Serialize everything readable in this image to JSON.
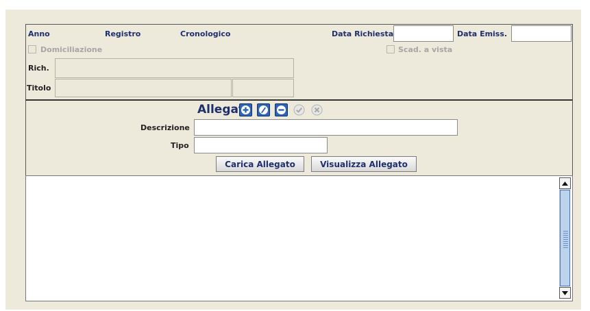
{
  "header": {
    "anno_label": "Anno",
    "registro_label": "Registro",
    "cronologico_label": "Cronologico",
    "data_richiesta_label": "Data Richiesta",
    "data_richiesta_value": "",
    "data_emiss_label": "Data Emiss.",
    "data_emiss_value": "",
    "domiciliazione_label": "Domiciliazione",
    "domiciliazione_checked": false,
    "scad_vista_label": "Scad. a vista",
    "scad_vista_checked": false,
    "rich_label": "Rich.",
    "rich_value": "",
    "titolo_label": "Titolo",
    "titolo_value": "",
    "titolo_code_value": ""
  },
  "allegati": {
    "title": "Allegati",
    "icons": [
      "add-icon",
      "edit-icon",
      "remove-icon",
      "confirm-icon",
      "cancel-icon"
    ],
    "descrizione_label": "Descrizione",
    "descrizione_value": "",
    "tipo_label": "Tipo",
    "tipo_value": "",
    "carica_label": "Carica Allegato",
    "visualizza_label": "Visualizza Allegato"
  },
  "list": {
    "items": []
  },
  "colors": {
    "label": "#1f2f6e",
    "disabled": "#a6a6a6",
    "panel_bg": "#ede9db",
    "active_icon": "#2d64b8"
  }
}
